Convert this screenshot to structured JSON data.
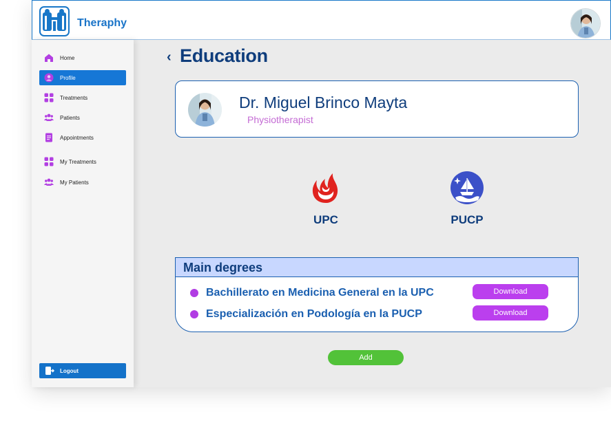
{
  "app": {
    "brand": "Theraphy"
  },
  "sidebar": {
    "items": [
      {
        "label": "Home",
        "icon": "home-icon"
      },
      {
        "label": "Profile",
        "icon": "profile-icon",
        "active": true
      },
      {
        "label": "Treatments",
        "icon": "grid-icon"
      },
      {
        "label": "Patients",
        "icon": "people-icon"
      },
      {
        "label": "Appointments",
        "icon": "document-icon"
      },
      {
        "label": "My Treatments",
        "icon": "grid-icon"
      },
      {
        "label": "My Patients",
        "icon": "people-icon"
      }
    ],
    "logout_label": "Logout"
  },
  "page": {
    "title": "Education"
  },
  "doctor": {
    "name": "Dr. Miguel Brinco Mayta",
    "role": "Physiotherapist"
  },
  "universities": [
    {
      "name": "UPC",
      "logo": "upc-logo-icon"
    },
    {
      "name": "PUCP",
      "logo": "pucp-logo-icon"
    }
  ],
  "degrees": {
    "heading": "Main degrees",
    "items": [
      {
        "title": "Bachillerato en Medicina General en la UPC",
        "button": "Download"
      },
      {
        "title": "Especialización en Podología en la PUCP",
        "button": "Download"
      }
    ]
  },
  "actions": {
    "add_label": "Add"
  },
  "colors": {
    "primary": "#1677d6",
    "title": "#0f3d7c",
    "accent_purple": "#bb3fee",
    "add_green": "#52c239",
    "degree_header": "#c8d7ff",
    "upc_red": "#e0231f",
    "pucp_blue": "#3b50c8"
  }
}
